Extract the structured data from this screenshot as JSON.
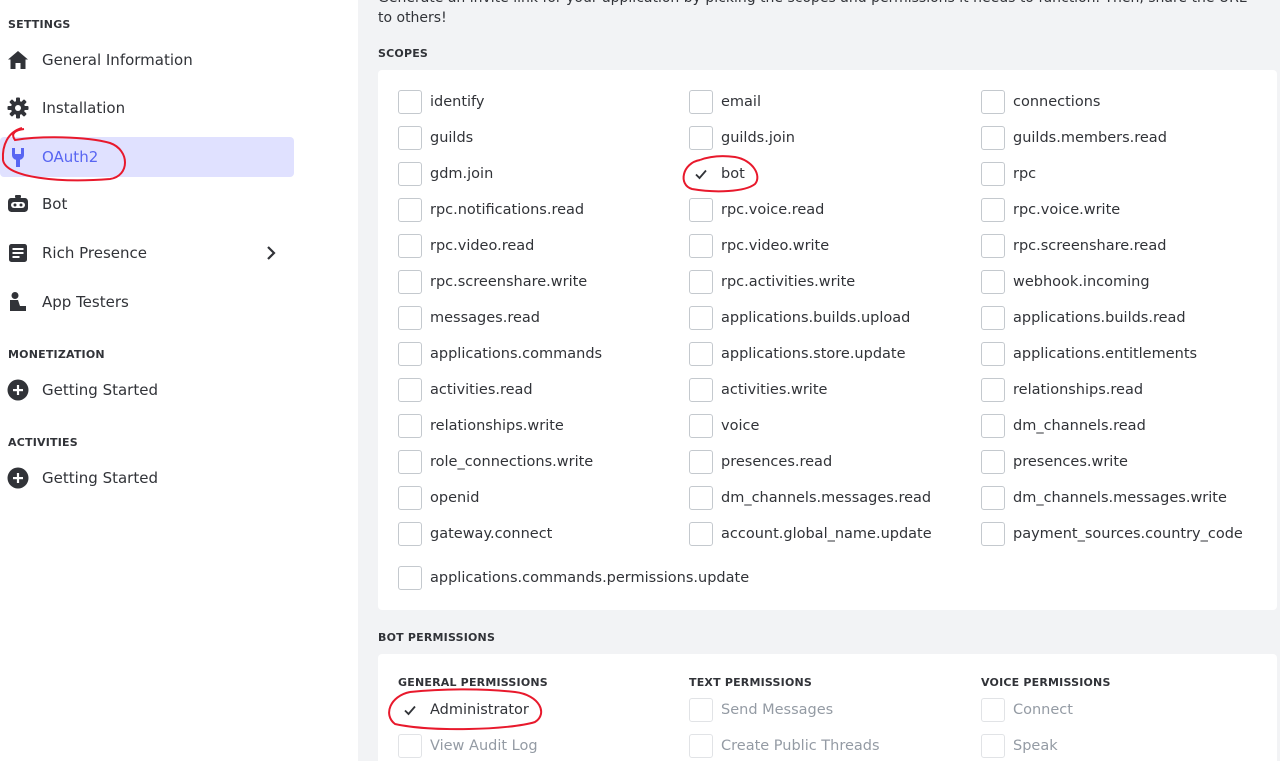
{
  "sidebar": {
    "settings_head": "SETTINGS",
    "items": [
      {
        "label": "General Information",
        "icon": "home-icon"
      },
      {
        "label": "Installation",
        "icon": "gear-icon"
      },
      {
        "label": "OAuth2",
        "icon": "wrench-icon",
        "active": true
      },
      {
        "label": "Bot",
        "icon": "bot-icon"
      },
      {
        "label": "Rich Presence",
        "icon": "document-icon"
      },
      {
        "label": "App Testers",
        "icon": "user-icon"
      }
    ],
    "monetization_head": "MONETIZATION",
    "monetization_item": "Getting Started",
    "activities_head": "ACTIVITIES",
    "activities_item": "Getting Started"
  },
  "main": {
    "intro": "Generate an invite link for your application by picking the scopes and permissions it needs to function. Then, share the URL to others!",
    "scopes_head": "SCOPES",
    "scopes": [
      {
        "label": "identify",
        "checked": false
      },
      {
        "label": "email",
        "checked": false
      },
      {
        "label": "connections",
        "checked": false
      },
      {
        "label": "guilds",
        "checked": false
      },
      {
        "label": "guilds.join",
        "checked": false
      },
      {
        "label": "guilds.members.read",
        "checked": false
      },
      {
        "label": "gdm.join",
        "checked": false
      },
      {
        "label": "bot",
        "checked": true
      },
      {
        "label": "rpc",
        "checked": false
      },
      {
        "label": "rpc.notifications.read",
        "checked": false
      },
      {
        "label": "rpc.voice.read",
        "checked": false
      },
      {
        "label": "rpc.voice.write",
        "checked": false
      },
      {
        "label": "rpc.video.read",
        "checked": false
      },
      {
        "label": "rpc.video.write",
        "checked": false
      },
      {
        "label": "rpc.screenshare.read",
        "checked": false
      },
      {
        "label": "rpc.screenshare.write",
        "checked": false
      },
      {
        "label": "rpc.activities.write",
        "checked": false
      },
      {
        "label": "webhook.incoming",
        "checked": false
      },
      {
        "label": "messages.read",
        "checked": false
      },
      {
        "label": "applications.builds.upload",
        "checked": false
      },
      {
        "label": "applications.builds.read",
        "checked": false
      },
      {
        "label": "applications.commands",
        "checked": false
      },
      {
        "label": "applications.store.update",
        "checked": false
      },
      {
        "label": "applications.entitlements",
        "checked": false
      },
      {
        "label": "activities.read",
        "checked": false
      },
      {
        "label": "activities.write",
        "checked": false
      },
      {
        "label": "relationships.read",
        "checked": false
      },
      {
        "label": "relationships.write",
        "checked": false
      },
      {
        "label": "voice",
        "checked": false
      },
      {
        "label": "dm_channels.read",
        "checked": false
      },
      {
        "label": "role_connections.write",
        "checked": false
      },
      {
        "label": "presences.read",
        "checked": false
      },
      {
        "label": "presences.write",
        "checked": false
      },
      {
        "label": "openid",
        "checked": false
      },
      {
        "label": "dm_channels.messages.read",
        "checked": false
      },
      {
        "label": "dm_channels.messages.write",
        "checked": false
      },
      {
        "label": "gateway.connect",
        "checked": false
      },
      {
        "label": "account.global_name.update",
        "checked": false
      },
      {
        "label": "payment_sources.country_code",
        "checked": false
      },
      {
        "label": "applications.commands.permissions.update",
        "checked": false
      }
    ],
    "bot_permissions_head": "BOT PERMISSIONS",
    "general_head": "GENERAL PERMISSIONS",
    "text_head": "TEXT PERMISSIONS",
    "voice_head": "VOICE PERMISSIONS",
    "general": [
      {
        "label": "Administrator",
        "checked": true,
        "disabled": false
      },
      {
        "label": "View Audit Log",
        "checked": false,
        "disabled": true
      }
    ],
    "text": [
      {
        "label": "Send Messages",
        "checked": false,
        "disabled": true
      },
      {
        "label": "Create Public Threads",
        "checked": false,
        "disabled": true
      }
    ],
    "voice": [
      {
        "label": "Connect",
        "checked": false,
        "disabled": true
      },
      {
        "label": "Speak",
        "checked": false,
        "disabled": true
      }
    ]
  },
  "colors": {
    "accent": "#5865f2",
    "active_bg": "#e0e1ff",
    "annotation": "#e8192c"
  }
}
